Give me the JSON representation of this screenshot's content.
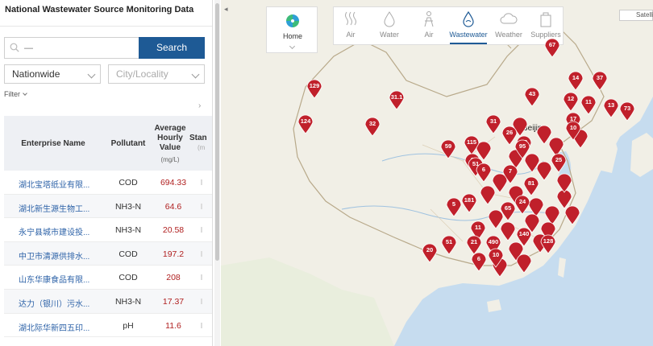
{
  "panel": {
    "title": "National Wastewater Source Monitoring Data",
    "search": {
      "placeholder": "—",
      "button_label": "Search"
    },
    "region_select": "Nationwide",
    "city_placeholder": "City/Locality",
    "filter_label": "Filter",
    "scroll_indicator": "›"
  },
  "table": {
    "headers": {
      "name": "Enterprise Name",
      "pollutant": "Pollutant",
      "value": "Average Hourly Value",
      "unit": "(mg/L)",
      "standard": "Stan",
      "standard_sub": "(m"
    },
    "rows": [
      {
        "name": "湖北宝塔纸业有限...",
        "pollutant": "COD",
        "value": "694.33"
      },
      {
        "name": "湖北新生源生物工...",
        "pollutant": "NH3-N",
        "value": "64.6"
      },
      {
        "name": "永宁县城市建设投...",
        "pollutant": "NH3-N",
        "value": "20.58"
      },
      {
        "name": "中卫市清源供排水...",
        "pollutant": "COD",
        "value": "197.2"
      },
      {
        "name": "山东华康食品有限...",
        "pollutant": "COD",
        "value": "208"
      },
      {
        "name": "达力（银川）污水...",
        "pollutant": "NH3-N",
        "value": "17.37"
      },
      {
        "name": "湖北际华新四五印...",
        "pollutant": "pH",
        "value": "11.6"
      }
    ]
  },
  "map": {
    "collapse_arrow": "◂",
    "home_label": "Home",
    "layers": [
      {
        "label": "Air",
        "icon": "air-icon",
        "active": false
      },
      {
        "label": "Water",
        "icon": "water-drop-icon",
        "active": false
      },
      {
        "label": "Air",
        "icon": "person-icon",
        "active": false
      },
      {
        "label": "Wastewater",
        "icon": "wastewater-drop-icon",
        "active": true
      },
      {
        "label": "Weather",
        "icon": "cloud-icon",
        "active": false
      },
      {
        "label": "Suppliers",
        "icon": "bag-icon",
        "active": false
      }
    ],
    "satellite_label": "Satellite",
    "city_label": "Beijing",
    "pin_color": "#c0202b",
    "markers": [
      "129",
      "31.1",
      "124",
      "32",
      "67",
      "43",
      "14",
      "37",
      "12",
      "11",
      "13",
      "17",
      "10",
      "73",
      "31",
      "26",
      "33",
      "59",
      "115",
      "95",
      "9",
      "51",
      "7",
      "25",
      "6",
      "81",
      "5",
      "181",
      "65",
      "24",
      "11",
      "140",
      "490",
      "21",
      "20",
      "51",
      "6",
      "128",
      "10"
    ]
  },
  "colors": {
    "accent": "#1e5a95",
    "value_text": "#b02020",
    "link_text": "#2e63a8"
  }
}
